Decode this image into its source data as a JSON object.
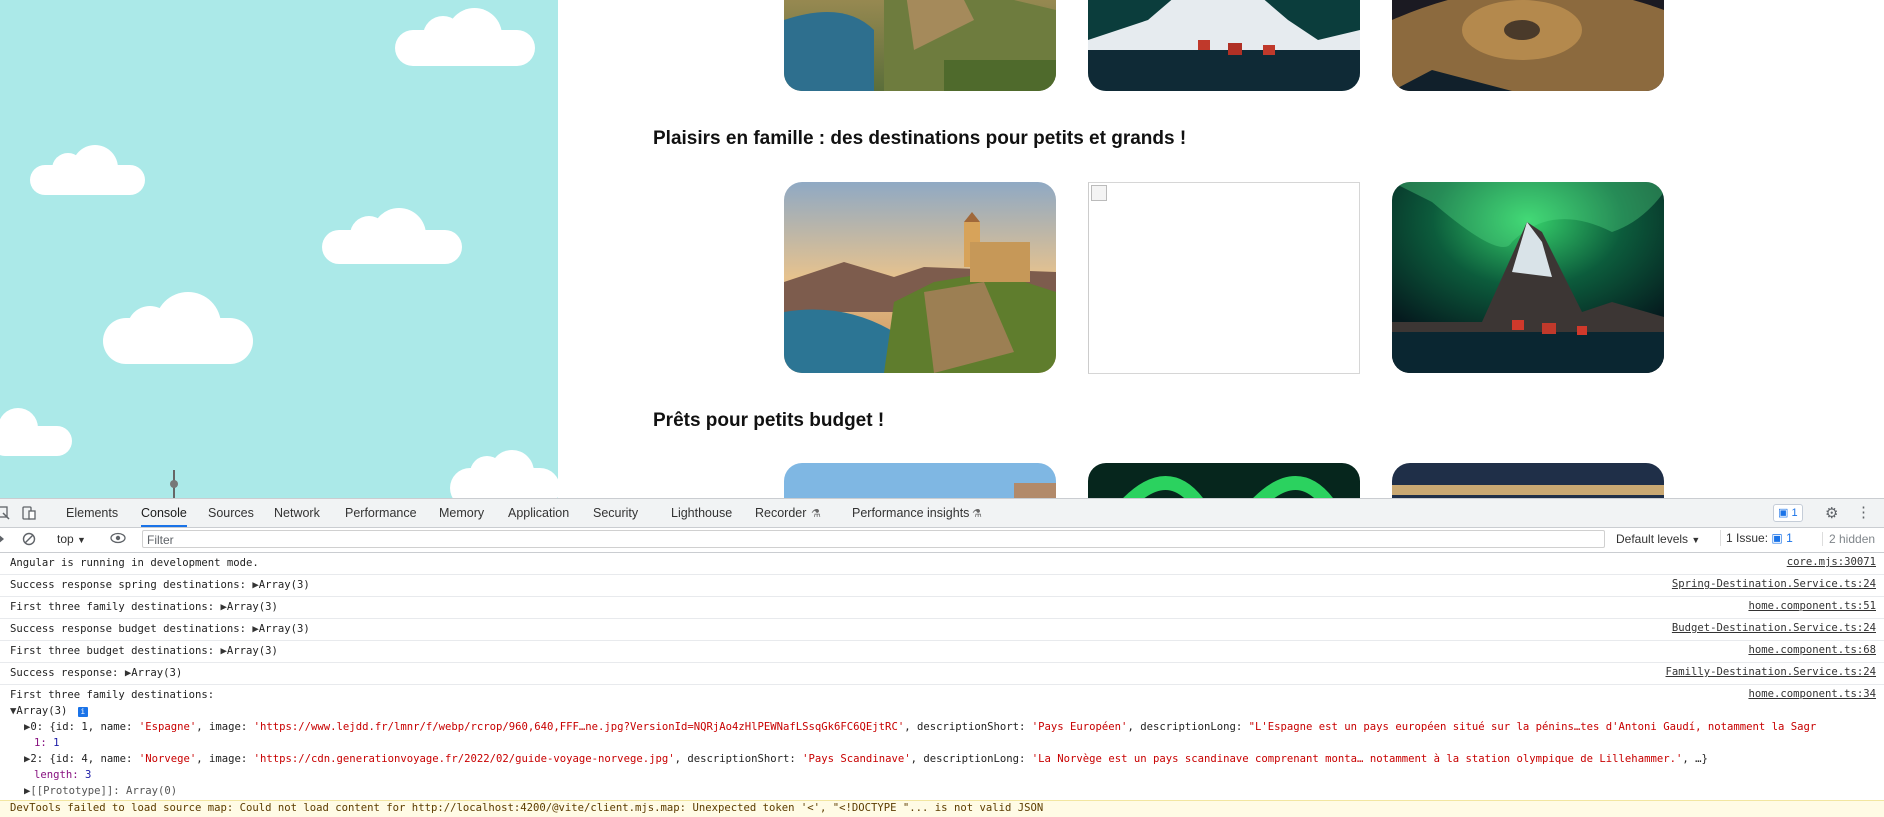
{
  "page": {
    "section_family_heading": "Plaisirs en famille : des destinations pour petits et grands !",
    "section_budget_heading": "Prêts pour petits budget !"
  },
  "devtools": {
    "tabs": [
      "Elements",
      "Console",
      "Sources",
      "Network",
      "Performance",
      "Memory",
      "Application",
      "Security",
      "Lighthouse",
      "Recorder",
      "Performance insights"
    ],
    "issues_badge": "1",
    "toolbar": {
      "context": "top",
      "filter_placeholder": "Filter",
      "levels": "Default levels",
      "issues": "1 Issue:",
      "issues_count": "1",
      "hidden": "2 hidden"
    },
    "console": {
      "messages": [
        {
          "text": "Angular is running in development mode.",
          "expand": "",
          "source": "core.mjs:30071"
        },
        {
          "text": "Success response spring destinations: ",
          "expand": "Array(3)",
          "source": "Spring-Destination.Service.ts:24"
        },
        {
          "text": "First three family destinations: ",
          "expand": "Array(3)",
          "source": "home.component.ts:51"
        },
        {
          "text": "Success response budget destinations: ",
          "expand": "Array(3)",
          "source": "Budget-Destination.Service.ts:24"
        },
        {
          "text": "First three budget destinations: ",
          "expand": "Array(3)",
          "source": "home.component.ts:68"
        },
        {
          "text": "Success response: ",
          "expand": "Array(3)",
          "source": "Familly-Destination.Service.ts:24"
        },
        {
          "text": "First three family destinations:",
          "expand": "",
          "source": "home.component.ts:34"
        }
      ],
      "array_header": "Array(3)",
      "item0": {
        "prefix": "0: {id: 1, name: ",
        "name": "'Espagne'",
        "image_key": ", image: ",
        "image": "'https://www.lejdd.fr/lmnr/f/webp/rcrop/960,640,FFF…ne.jpg?VersionId=NQRjAo4zHlPEWNafLSsqGk6FC6QEjtRC'",
        "ds_key": ", descriptionShort: ",
        "ds": "'Pays Européen'",
        "dl_key": ", descriptionLong: ",
        "dl": "\"L'Espagne est un pays européen situé sur la pénins…tes d'Antoni Gaudí, notamment la Sagr"
      },
      "item1_key": "1: ",
      "item1_val": "1",
      "item2": {
        "prefix": "2: {id: 4, name: ",
        "name": "'Norvege'",
        "image_key": ", image: ",
        "image": "'https://cdn.generationvoyage.fr/2022/02/guide-voyage-norvege.jpg'",
        "ds_key": ", descriptionShort: ",
        "ds": "'Pays Scandinave'",
        "dl_key": ", descriptionLong: ",
        "dl": "'La Norvège est un pays scandinave comprenant monta… notamment à la station olympique de Lillehammer.'",
        "suffix": ", …}"
      },
      "length_key": "length: ",
      "length_val": "3",
      "prototype": "[[Prototype]]: Array(0)",
      "warning": "DevTools failed to load source map: Could not load content for http://localhost:4200/@vite/client.mjs.map: Unexpected token '<', \"<!DOCTYPE \"... is not valid JSON"
    }
  },
  "colors": {
    "sky": "#abe9e8",
    "accent": "#1a73e8",
    "string": "#c80000"
  }
}
